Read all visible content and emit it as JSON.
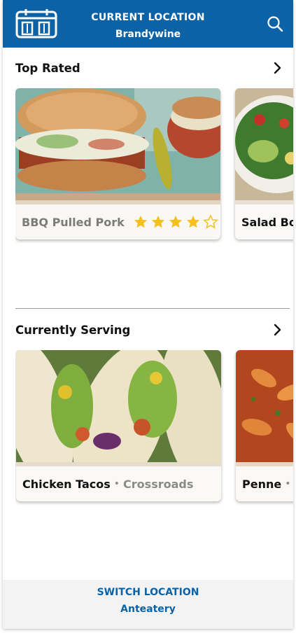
{
  "header": {
    "title": "CURRENT LOCATION",
    "location": "Brandywine",
    "calendar_icon": "calendar-icon",
    "search_icon": "search-icon"
  },
  "top_rated": {
    "title": "Top Rated",
    "items": [
      {
        "name": "BBQ Pulled Pork",
        "rating": 4,
        "max_rating": 5
      },
      {
        "name": "Salad Bowl"
      }
    ]
  },
  "currently_serving": {
    "title": "Currently Serving",
    "items": [
      {
        "name": "Chicken Tacos",
        "location": "Crossroads"
      },
      {
        "name": "Penne",
        "location": ""
      }
    ]
  },
  "footer": {
    "action": "SWITCH LOCATION",
    "location": "Anteatery"
  },
  "colors": {
    "brand_blue": "#0b62a6",
    "star_gold": "#f4c01e"
  }
}
